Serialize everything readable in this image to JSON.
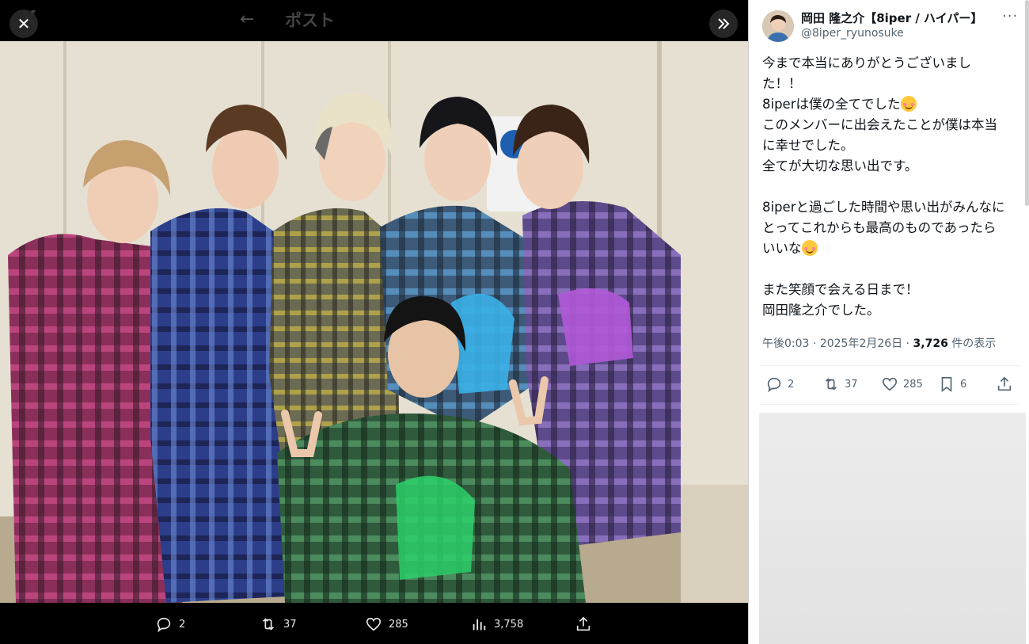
{
  "viewer": {
    "header_title": "ポスト",
    "back_icon": "arrow-left-icon",
    "close_icon": "close-icon",
    "expand_icon": "chevrons-right-icon",
    "logo_text": "X",
    "actions": {
      "replies": "2",
      "reposts": "37",
      "likes": "285",
      "views": "3,758"
    }
  },
  "post": {
    "author_name": "岡田 隆之介【8iper / ハイパー】",
    "author_handle": "@8iper_ryunosuke",
    "lines": [
      "今まで本当にありがとうございまし",
      "た！！",
      "8iperは僕の全てでした",
      "このメンバーに出会えたことが僕は本当",
      "に幸せでした。",
      "全てが大切な思い出です。",
      "",
      "8iperと過ごした時間や思い出がみんなに",
      "とってこれからも最高のものであったら",
      "いいな",
      "",
      "また笑顔で会える日まで！",
      "岡田隆之介でした。"
    ],
    "time": "午後0:03",
    "date": "2025年2月26日",
    "separator": "·",
    "views_count": "3,726",
    "views_label": "件の表示",
    "actions": {
      "replies": "2",
      "reposts": "37",
      "likes": "285",
      "bookmarks": "6"
    }
  },
  "colors": {
    "accent_blue": "#1d9bf0",
    "text_primary": "#0f1419",
    "text_secondary": "#536471"
  }
}
